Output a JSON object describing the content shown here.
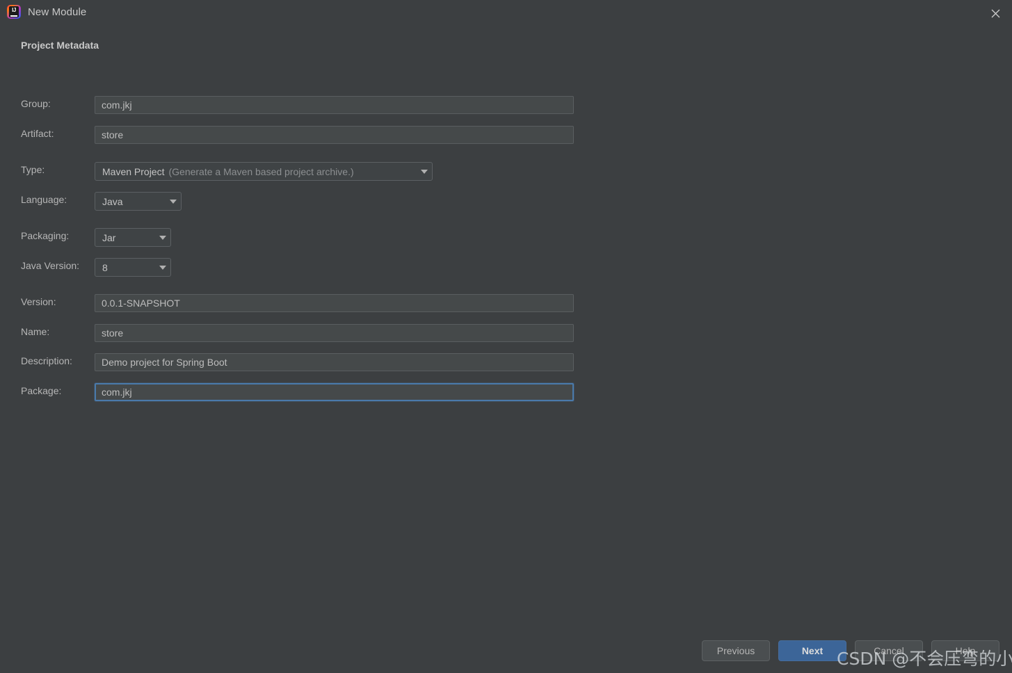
{
  "window": {
    "title": "New Module",
    "app_icon": "intellij-idea-icon",
    "close_icon": "close-icon"
  },
  "section": {
    "title": "Project Metadata"
  },
  "fields": {
    "group": {
      "label": "Group:",
      "value": "com.jkj"
    },
    "artifact": {
      "label": "Artifact:",
      "value": "store"
    },
    "type": {
      "label": "Type:",
      "value": "Maven Project",
      "hint": "(Generate a Maven based project archive.)",
      "dropdown_icon": "chevron-down-icon"
    },
    "language": {
      "label": "Language:",
      "value": "Java",
      "dropdown_icon": "chevron-down-icon"
    },
    "packaging": {
      "label": "Packaging:",
      "value": "Jar",
      "dropdown_icon": "chevron-down-icon"
    },
    "java_version": {
      "label": "Java Version:",
      "value": "8",
      "dropdown_icon": "chevron-down-icon"
    },
    "version": {
      "label": "Version:",
      "value": "0.0.1-SNAPSHOT"
    },
    "name": {
      "label": "Name:",
      "value": "store"
    },
    "description": {
      "label": "Description:",
      "value": "Demo project for Spring Boot"
    },
    "package": {
      "label": "Package:",
      "value": "com.jkj",
      "focused": true
    }
  },
  "buttons": {
    "previous": "Previous",
    "next": "Next",
    "cancel": "Cancel",
    "help": "Help"
  },
  "watermark": {
    "text": "CSDN @不会压弯的小飞侠"
  },
  "colors": {
    "dialog_background": "#3c3f41",
    "field_background": "#45494a",
    "field_border": "#5a5e60",
    "focus_border": "#4a7aab",
    "primary_button": "#3c6598",
    "text": "#bbbbbb",
    "muted_text": "#8c8f91"
  }
}
